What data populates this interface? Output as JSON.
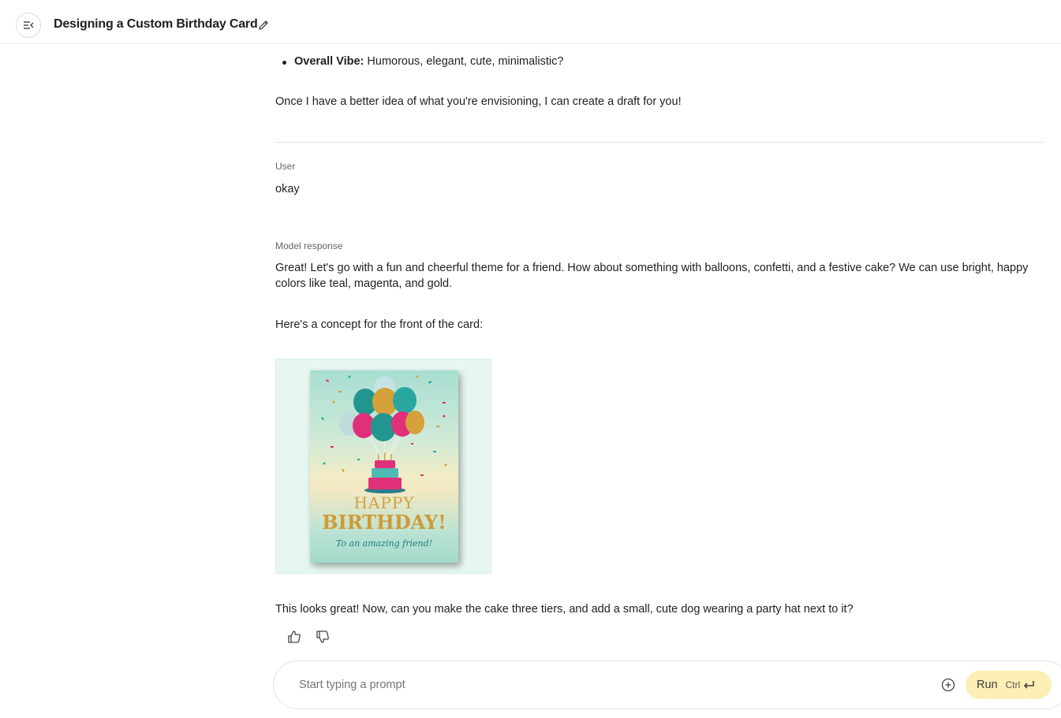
{
  "header": {
    "title": "Designing a Custom Birthday Card"
  },
  "conversation": {
    "bullet": {
      "label": "Overall Vibe:",
      "text": " Humorous, elegant, cute, minimalistic?"
    },
    "closing_line": "Once I have a better idea of what you're envisioning, I can create a draft for you!",
    "user_role": "User",
    "user_message": "okay",
    "model_role": "Model response",
    "model_para1": "Great! Let's go with a fun and cheerful theme for a friend. How about something with balloons, confetti, and a festive cake? We can use bright, happy colors like teal, magenta, and gold.",
    "model_para2": "Here's a concept for the front of the card:",
    "card": {
      "line1": "HAPPY",
      "line2": "BIRTHDAY!",
      "line3": "To an amazing friend!"
    },
    "follow_up": "This looks great! Now, can you make the cake three tiers, and add a small, cute dog wearing a party hat next to it?"
  },
  "icons": {
    "menu": "menu-collapse-icon",
    "edit": "pencil-icon",
    "thumbs_up": "thumbs-up-icon",
    "thumbs_down": "thumbs-down-icon",
    "add": "plus-circle-icon",
    "enter": "enter-key-icon"
  },
  "prompt": {
    "placeholder": "Start typing a prompt",
    "run_label": "Run",
    "shortcut": "Ctrl"
  },
  "colors": {
    "run_button_bg": "#fbefb5",
    "card_frame_bg": "#e7f7f0",
    "teal": "#2aa6a0",
    "magenta": "#e0307a",
    "gold": "#d4a13a"
  }
}
